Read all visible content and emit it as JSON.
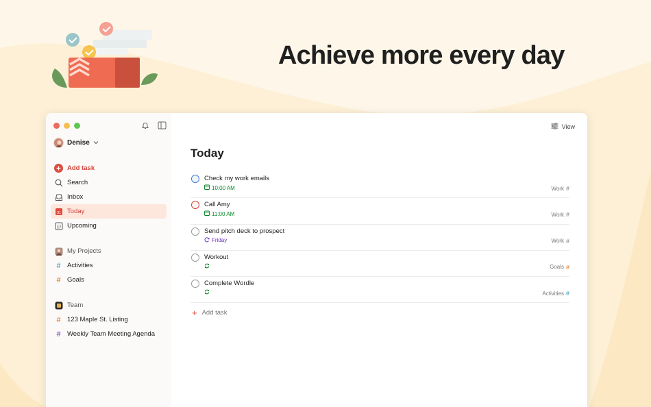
{
  "headline": "Achieve more every day",
  "colors": {
    "background": "#fdf0d6",
    "brand_red": "#d1453b",
    "active_bg": "#fde6dc",
    "due_green": "#058527",
    "due_purple": "#692fc2",
    "priority_blue": "#3e7ad3"
  },
  "sidebar": {
    "icons": [
      "bell-icon",
      "sidebar-toggle-icon"
    ],
    "user": {
      "name": "Denise",
      "icon": "chevron-down-icon"
    },
    "nav": [
      {
        "label": "Add task",
        "icon": "plus-circle-icon"
      },
      {
        "label": "Search",
        "icon": "search-icon"
      },
      {
        "label": "Inbox",
        "icon": "inbox-icon"
      },
      {
        "label": "Today",
        "icon": "calendar-today-icon",
        "badge": "31"
      },
      {
        "label": "Upcoming",
        "icon": "calendar-grid-icon"
      }
    ],
    "my_projects": {
      "label": "My Projects",
      "items": [
        {
          "label": "Activities",
          "color": "#4fa8c9"
        },
        {
          "label": "Goals",
          "color": "#e98b43"
        }
      ]
    },
    "team": {
      "label": "Team",
      "items": [
        {
          "label": "123 Maple St. Listing",
          "color": "#e98b43"
        },
        {
          "label": "Weekly Team Meeting Agenda",
          "color": "#8a63d2"
        }
      ]
    }
  },
  "main": {
    "view_label": "View",
    "title": "Today",
    "tasks": [
      {
        "name": "Check my work emails",
        "due": "10:00 AM",
        "due_type": "time",
        "project": "Work",
        "priority": "p2"
      },
      {
        "name": "Call Amy",
        "due": "11:00 AM",
        "due_type": "time",
        "project": "Work",
        "priority": "p1"
      },
      {
        "name": "Send pitch deck to prospect",
        "due": "Friday",
        "due_type": "date",
        "project": "Work",
        "priority": "none"
      },
      {
        "name": "Workout",
        "due": "",
        "due_type": "recurring",
        "project": "Goals",
        "priority": "none"
      },
      {
        "name": "Complete Wordle",
        "due": "",
        "due_type": "recurring",
        "project": "Activities",
        "priority": "none"
      }
    ],
    "add_task_label": "Add task"
  }
}
